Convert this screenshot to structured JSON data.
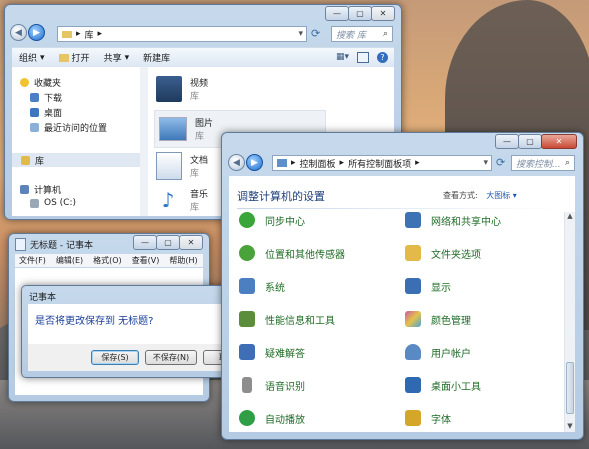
{
  "explorer": {
    "address": "库",
    "search_placeholder": "搜索 库",
    "toolbar": {
      "organize": "组织",
      "open": "打开",
      "share": "共享",
      "new_library": "新建库"
    },
    "nav": [
      {
        "label": "收藏夹",
        "icon": "star-icon"
      },
      {
        "label": "下载",
        "icon": "download-icon"
      },
      {
        "label": "桌面",
        "icon": "desktop-icon"
      },
      {
        "label": "最近访问的位置",
        "icon": "recent-icon"
      },
      {
        "label": "库",
        "icon": "library-icon"
      },
      {
        "label": "计算机",
        "icon": "computer-icon"
      },
      {
        "label": "OS (C:)",
        "icon": "drive-icon"
      }
    ],
    "libraries": [
      {
        "name": "视频",
        "type": "库"
      },
      {
        "name": "图片",
        "type": "库"
      },
      {
        "name": "文档",
        "type": "库"
      },
      {
        "name": "音乐",
        "type": "库"
      }
    ]
  },
  "notepad": {
    "title": "无标题 - 记事本",
    "menu": [
      "文件(F)",
      "编辑(E)",
      "格式(O)",
      "查看(V)",
      "帮助(H)"
    ]
  },
  "dialog": {
    "title": "记事本",
    "message": "是否将更改保存到 无标题?",
    "save": "保存(S)",
    "dont_save": "不保存(N)",
    "cancel": "取消"
  },
  "control_panel": {
    "breadcrumb": [
      "控制面板",
      "所有控制面板项"
    ],
    "search_placeholder": "搜索控制...",
    "heading": "调整计算机的设置",
    "view_by_label": "查看方式:",
    "view_by_value": "大图标",
    "items_left": [
      {
        "label": "同步中心",
        "icon": "sync-center-icon",
        "color": "#3aa63a"
      },
      {
        "label": "位置和其他传感器",
        "icon": "location-sensor-icon",
        "color": "#49a33a"
      },
      {
        "label": "系统",
        "icon": "system-icon",
        "color": "#4b7fc1"
      },
      {
        "label": "性能信息和工具",
        "icon": "performance-icon",
        "color": "#5c8d3a"
      },
      {
        "label": "疑难解答",
        "icon": "troubleshooting-icon",
        "color": "#3e6fb6"
      },
      {
        "label": "语音识别",
        "icon": "microphone-icon",
        "color": "#8d8d8d"
      },
      {
        "label": "自动播放",
        "icon": "autoplay-icon",
        "color": "#2f9e45"
      }
    ],
    "items_right": [
      {
        "label": "网络和共享中心",
        "icon": "network-icon",
        "color": "#3d73b5"
      },
      {
        "label": "文件夹选项",
        "icon": "folder-options-icon",
        "color": "#e3b94a"
      },
      {
        "label": "显示",
        "icon": "display-icon",
        "color": "#3b6fb3"
      },
      {
        "label": "颜色管理",
        "icon": "color-management-icon",
        "color": "#c85aa0"
      },
      {
        "label": "用户帐户",
        "icon": "user-accounts-icon",
        "color": "#5a8ac4"
      },
      {
        "label": "桌面小工具",
        "icon": "gadgets-icon",
        "color": "#2e69b1"
      },
      {
        "label": "字体",
        "icon": "fonts-icon",
        "color": "#d4a62a"
      }
    ]
  }
}
